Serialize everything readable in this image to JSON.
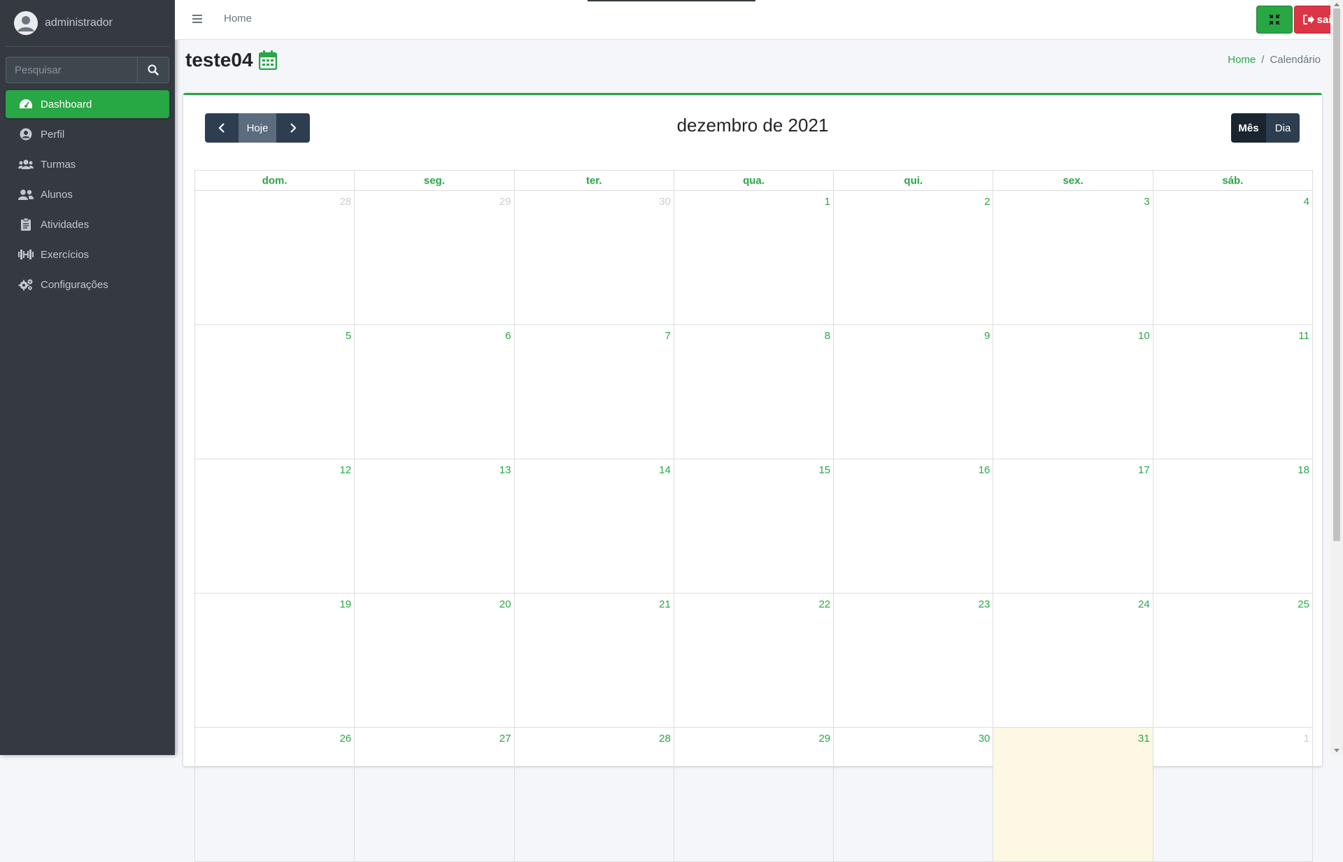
{
  "sidebar": {
    "user_name": "administrador",
    "search_placeholder": "Pesquisar",
    "items": [
      {
        "label": "Dashboard",
        "icon": "dashboard-icon",
        "active": true
      },
      {
        "label": "Perfil",
        "icon": "user-circle-icon"
      },
      {
        "label": "Turmas",
        "icon": "users-icon"
      },
      {
        "label": "Alunos",
        "icon": "user-friends-icon"
      },
      {
        "label": "Atividades",
        "icon": "clipboard-icon"
      },
      {
        "label": "Exercícios",
        "icon": "dumbbell-icon"
      },
      {
        "label": "Configurações",
        "icon": "cogs-icon"
      }
    ]
  },
  "topbar": {
    "home_label": "Home",
    "logout_label": "sair",
    "fullscreen_icon": "compress-icon"
  },
  "header": {
    "title": "teste04",
    "breadcrumb": {
      "home": "Home",
      "current": "Calendário"
    }
  },
  "calendar": {
    "title": "dezembro de 2021",
    "today_label": "Hoje",
    "month_label": "Mês",
    "day_label": "Dia",
    "weekdays": [
      "dom.",
      "seg.",
      "ter.",
      "qua.",
      "qui.",
      "sex.",
      "sáb."
    ],
    "weeks": [
      [
        "28",
        "29",
        "30",
        "1",
        "2",
        "3",
        "4"
      ],
      [
        "5",
        "6",
        "7",
        "8",
        "9",
        "10",
        "11"
      ],
      [
        "12",
        "13",
        "14",
        "15",
        "16",
        "17",
        "18"
      ],
      [
        "19",
        "20",
        "21",
        "22",
        "23",
        "24",
        "25"
      ],
      [
        "26",
        "27",
        "28",
        "29",
        "30",
        "31",
        "1"
      ]
    ],
    "other_month_days": [
      [
        0,
        0
      ],
      [
        0,
        1
      ],
      [
        0,
        2
      ],
      [
        4,
        6
      ]
    ],
    "today_cell": [
      4,
      5
    ]
  },
  "colors": {
    "accent": "#28a745",
    "danger": "#dc3545",
    "sidebar": "#343a40",
    "today_bg": "#fcf8e3"
  }
}
